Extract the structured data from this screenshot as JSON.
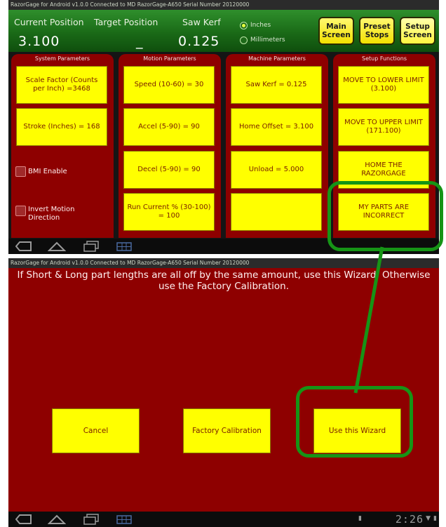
{
  "app": {
    "title_bar": "RazorGage for Android v1.0.0   Connected to MD RazorGage-A650   Serial Number 20120000"
  },
  "header": {
    "current_position_label": "Current Position",
    "current_position_value": "3.100",
    "target_position_label": "Target Position",
    "target_position_value": "_",
    "saw_kerf_label": "Saw Kerf",
    "saw_kerf_value": "0.125",
    "units": [
      {
        "label": "Inches",
        "selected": true
      },
      {
        "label": "Millimeters",
        "selected": false
      }
    ],
    "nav_buttons": [
      {
        "label": "Main Screen",
        "active": false
      },
      {
        "label": "Preset Stops",
        "active": false
      },
      {
        "label": "Setup Screen",
        "active": true
      }
    ]
  },
  "panels": {
    "system": {
      "title": "System Parameters",
      "tiles": [
        "Scale Factor (Counts per Inch) =3468",
        "Stroke (Inches) = 168"
      ],
      "checkboxes": [
        "BMI Enable",
        "Invert Motion Direction"
      ]
    },
    "motion": {
      "title": "Motion Parameters",
      "tiles": [
        "Speed (10-60) = 30",
        "Accel (5-90) = 90",
        "Decel (5-90) = 90",
        "Run Current % (30-100) = 100"
      ]
    },
    "machine": {
      "title": "Machine Parameters",
      "tiles": [
        "Saw Kerf = 0.125",
        "Home Offset = 3.100",
        "Unload = 5.000",
        ""
      ]
    },
    "setup": {
      "title": "Setup Functions",
      "tiles": [
        "MOVE TO LOWER LIMIT (3.100)",
        "MOVE TO UPPER LIMIT (171.100)",
        "HOME THE RAZORGAGE",
        "MY PARTS ARE INCORRECT"
      ]
    }
  },
  "wizard": {
    "message": "If Short & Long part lengths are all off by the same amount, use this Wizard. Otherwise use the Factory Calibration.",
    "buttons": [
      "Cancel",
      "Factory Calibration",
      "Use this Wizard"
    ]
  },
  "system_bar": {
    "clock": "2:26"
  },
  "colors": {
    "highlight": "#169416",
    "tile_yellow": "#ffff00",
    "panel_red": "#8e0000",
    "header_green": "#1a6a17"
  }
}
